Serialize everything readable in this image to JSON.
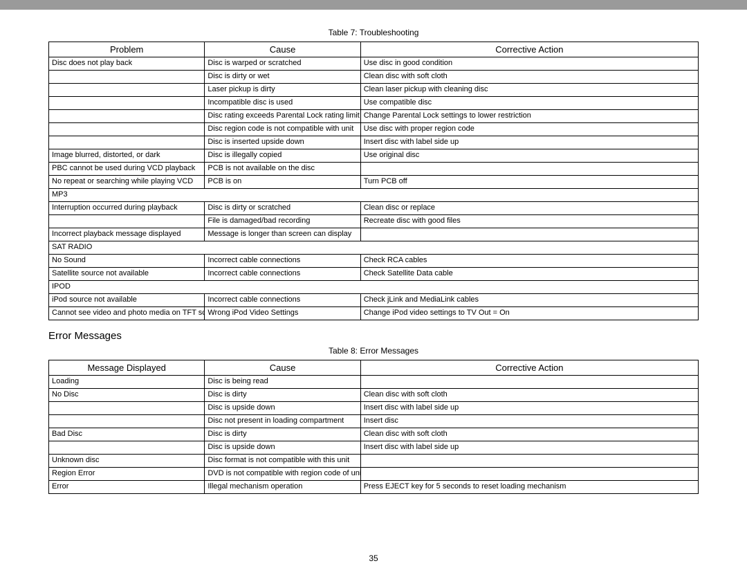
{
  "table7": {
    "title": "Table 7: Troubleshooting",
    "headers": [
      "Problem",
      "Cause",
      "Corrective Action"
    ],
    "rows": [
      [
        "Disc does not play back",
        "Disc is warped or scratched",
        "Use disc in good condition"
      ],
      [
        "",
        "Disc is dirty or wet",
        "Clean disc with soft cloth"
      ],
      [
        "",
        "Laser pickup is dirty",
        "Clean laser pickup with cleaning disc"
      ],
      [
        "",
        "Incompatible disc is used",
        "Use compatible disc"
      ],
      [
        "",
        "Disc rating exceeds Parental Lock rating limit",
        "Change Parental Lock settings to lower restriction"
      ],
      [
        "",
        "Disc region code is not compatible with unit",
        "Use disc with proper region code"
      ],
      [
        "",
        "Disc is inserted upside down",
        "Insert disc with label side up"
      ],
      [
        "Image blurred, distorted, or dark",
        "Disc is illegally copied",
        "Use original disc"
      ],
      [
        "PBC cannot be used during VCD playback",
        "PCB is not available on the disc",
        ""
      ],
      [
        "No repeat or searching while playing VCD",
        "PCB is on",
        "Turn PCB off"
      ],
      [
        "MP3",
        "__SPAN__",
        ""
      ],
      [
        "Interruption occurred during playback",
        "Disc is dirty or scratched",
        "Clean disc or replace"
      ],
      [
        "",
        "File is damaged/bad recording",
        "Recreate disc with good files"
      ],
      [
        "Incorrect playback message displayed",
        "Message is longer than screen can display",
        ""
      ],
      [
        "SAT RADIO",
        "__SPAN__",
        ""
      ],
      [
        "No Sound",
        "Incorrect cable connections",
        "Check RCA cables"
      ],
      [
        "Satellite source not available",
        "Incorrect cable connections",
        "Check Satellite Data cable"
      ],
      [
        "IPOD",
        "__SPAN__",
        ""
      ],
      [
        "iPod source not available",
        "Incorrect cable connections",
        "Check jLink and MediaLink cables"
      ],
      [
        "Cannot see video and photo media on TFT screen",
        "Wrong iPod Video Settings",
        "Change iPod video settings to TV Out = On"
      ]
    ]
  },
  "section_heading": "Error Messages",
  "table8": {
    "title": "Table 8: Error Messages",
    "headers": [
      "Message Displayed",
      "Cause",
      "Corrective Action"
    ],
    "rows": [
      [
        "Loading",
        "Disc is being read",
        ""
      ],
      [
        "No Disc",
        "Disc is dirty",
        "Clean disc with soft cloth"
      ],
      [
        "",
        "Disc is upside down",
        "Insert disc with label side up"
      ],
      [
        "",
        "Disc not present in loading compartment",
        "Insert disc"
      ],
      [
        "Bad Disc",
        "Disc is dirty",
        "Clean disc with soft cloth"
      ],
      [
        "",
        "Disc is upside down",
        "Insert disc with label side up"
      ],
      [
        "Unknown disc",
        "Disc format is not compatible with this unit",
        ""
      ],
      [
        "Region Error",
        "DVD is not compatible with region code of unit",
        ""
      ],
      [
        "Error",
        "Illegal mechanism operation",
        "Press EJECT key for 5 seconds to reset loading mechanism"
      ]
    ]
  },
  "page_number": "35"
}
